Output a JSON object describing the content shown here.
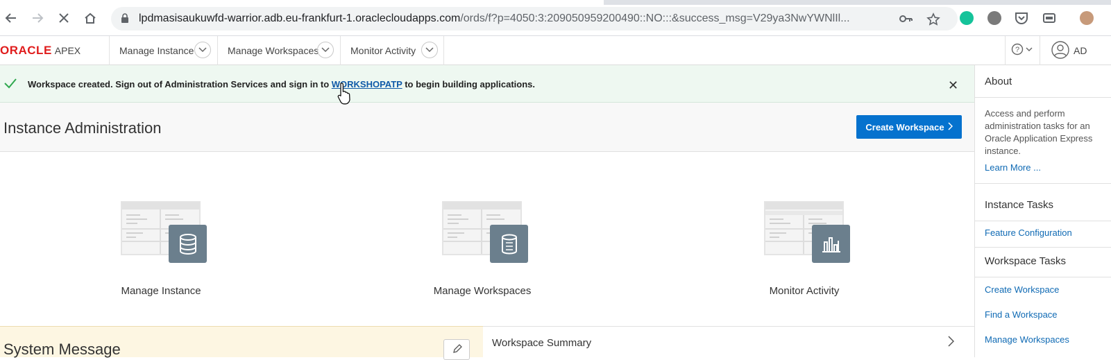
{
  "browser": {
    "url_host": "lpdmasisaukuwfd-warrior.adb.eu-frankfurt-1.oraclecloudapps.com",
    "url_path": "/ords/f?p=4050:3:209050959200490::NO:::&success_msg=V29ya3NwYWNlIl..."
  },
  "apex": {
    "logo": "ORACLE",
    "logo_suffix": "APEX",
    "menu": [
      {
        "label": "Manage Instance"
      },
      {
        "label": "Manage Workspaces"
      },
      {
        "label": "Monitor Activity"
      }
    ],
    "user_initials": "AD"
  },
  "alert": {
    "prefix": "Workspace created. Sign out of Administration Services and sign in to ",
    "link": "WORKSHOPATP",
    "suffix": " to begin building applications."
  },
  "page": {
    "title": "Instance Administration",
    "create_button": "Create Workspace"
  },
  "cards": [
    {
      "label": "Manage Instance"
    },
    {
      "label": "Manage Workspaces"
    },
    {
      "label": "Monitor Activity"
    }
  ],
  "sections": {
    "system_message": "System Message",
    "workspace_summary": "Workspace Summary"
  },
  "sidebar": {
    "about_title": "About",
    "about_text": "Access and perform administration tasks for an Oracle Application Express instance.",
    "learn_more": "Learn More ...",
    "instance_tasks_title": "Instance Tasks",
    "instance_tasks": [
      "Feature Configuration"
    ],
    "workspace_tasks_title": "Workspace Tasks",
    "workspace_tasks": [
      "Create Workspace",
      "Find a Workspace",
      "Manage Workspaces"
    ]
  },
  "colors": {
    "brand_red": "#e01c1c",
    "primary_blue": "#0572ce",
    "success_green": "#2fa84f",
    "card_badge": "#6b7f8d"
  }
}
